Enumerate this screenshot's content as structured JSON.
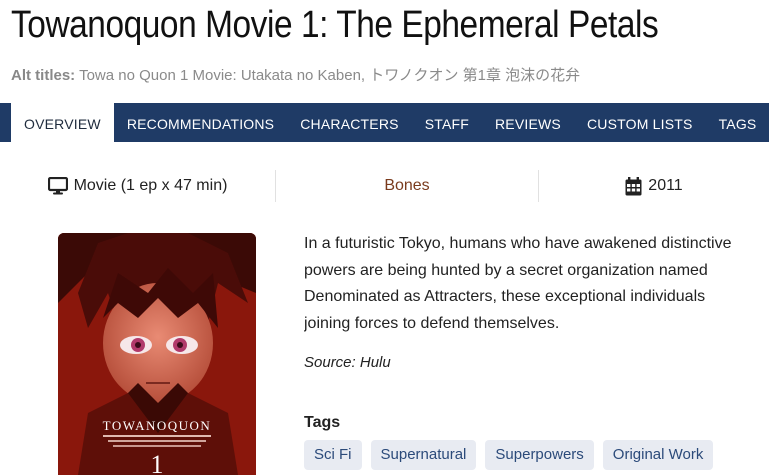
{
  "header": {
    "title": "Towanoquon Movie 1: The Ephemeral Petals",
    "alt_label": "Alt titles:",
    "alt_titles": "Towa no Quon 1 Movie: Utakata no Kaben, トワノクオン 第1章 泡沫の花弁"
  },
  "nav": {
    "tabs": [
      {
        "label": "Overview"
      },
      {
        "label": "Recommendations"
      },
      {
        "label": "Characters"
      },
      {
        "label": "Staff"
      },
      {
        "label": "Reviews"
      },
      {
        "label": "Custom Lists"
      },
      {
        "label": "Tags"
      }
    ],
    "active_tab": "Overview"
  },
  "info": {
    "type_icon": "monitor-icon",
    "type": "Movie (1 ep x 47 min)",
    "studio": "Bones",
    "year_icon": "calendar-icon",
    "year": "2011"
  },
  "poster": {
    "text": "TOWANOQUON",
    "number": "1"
  },
  "synopsis": {
    "lines": [
      "In a futuristic Tokyo, humans who have awakened distinctive",
      "powers are being hunted by a secret organization named",
      "Denominated as Attracters, these exceptional individuals",
      "joining forces to defend themselves."
    ],
    "source": "Source: Hulu"
  },
  "tags": {
    "heading": "Tags",
    "items": [
      {
        "label": "Sci Fi"
      },
      {
        "label": "Supernatural"
      },
      {
        "label": "Superpowers"
      },
      {
        "label": "Original Work"
      }
    ]
  },
  "colors": {
    "nav_bg": "#1f3b66",
    "studio_link": "#7a3b1d",
    "tag_bg": "#e8ebf2",
    "tag_text": "#2b4a7a"
  }
}
